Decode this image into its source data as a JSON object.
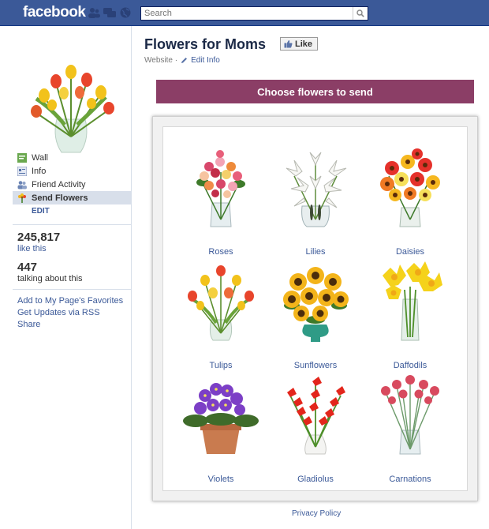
{
  "topbar": {
    "logo": "facebook",
    "search_placeholder": "Search"
  },
  "sidebar": {
    "nav": [
      {
        "label": "Wall",
        "icon": "wall-icon"
      },
      {
        "label": "Info",
        "icon": "info-icon"
      },
      {
        "label": "Friend Activity",
        "icon": "friends-icon"
      },
      {
        "label": "Send Flowers",
        "icon": "flower-icon",
        "active": true
      }
    ],
    "edit_label": "EDIT",
    "likes": {
      "number": "245,817",
      "caption": "like this"
    },
    "talking": {
      "number": "447",
      "caption": "talking about this"
    },
    "links": [
      "Add to My Page's Favorites",
      "Get Updates via RSS",
      "Share"
    ]
  },
  "page": {
    "title": "Flowers for Moms",
    "like_label": "Like",
    "category": "Website ·",
    "edit_info": "Edit Info"
  },
  "app": {
    "banner": "Choose flowers to send",
    "flowers": [
      {
        "name": "Roses"
      },
      {
        "name": "Lilies"
      },
      {
        "name": "Daisies"
      },
      {
        "name": "Tulips"
      },
      {
        "name": "Sunflowers"
      },
      {
        "name": "Daffodils"
      },
      {
        "name": "Violets"
      },
      {
        "name": "Gladiolus"
      },
      {
        "name": "Carnations"
      }
    ]
  },
  "footer": {
    "privacy": "Privacy Policy"
  }
}
